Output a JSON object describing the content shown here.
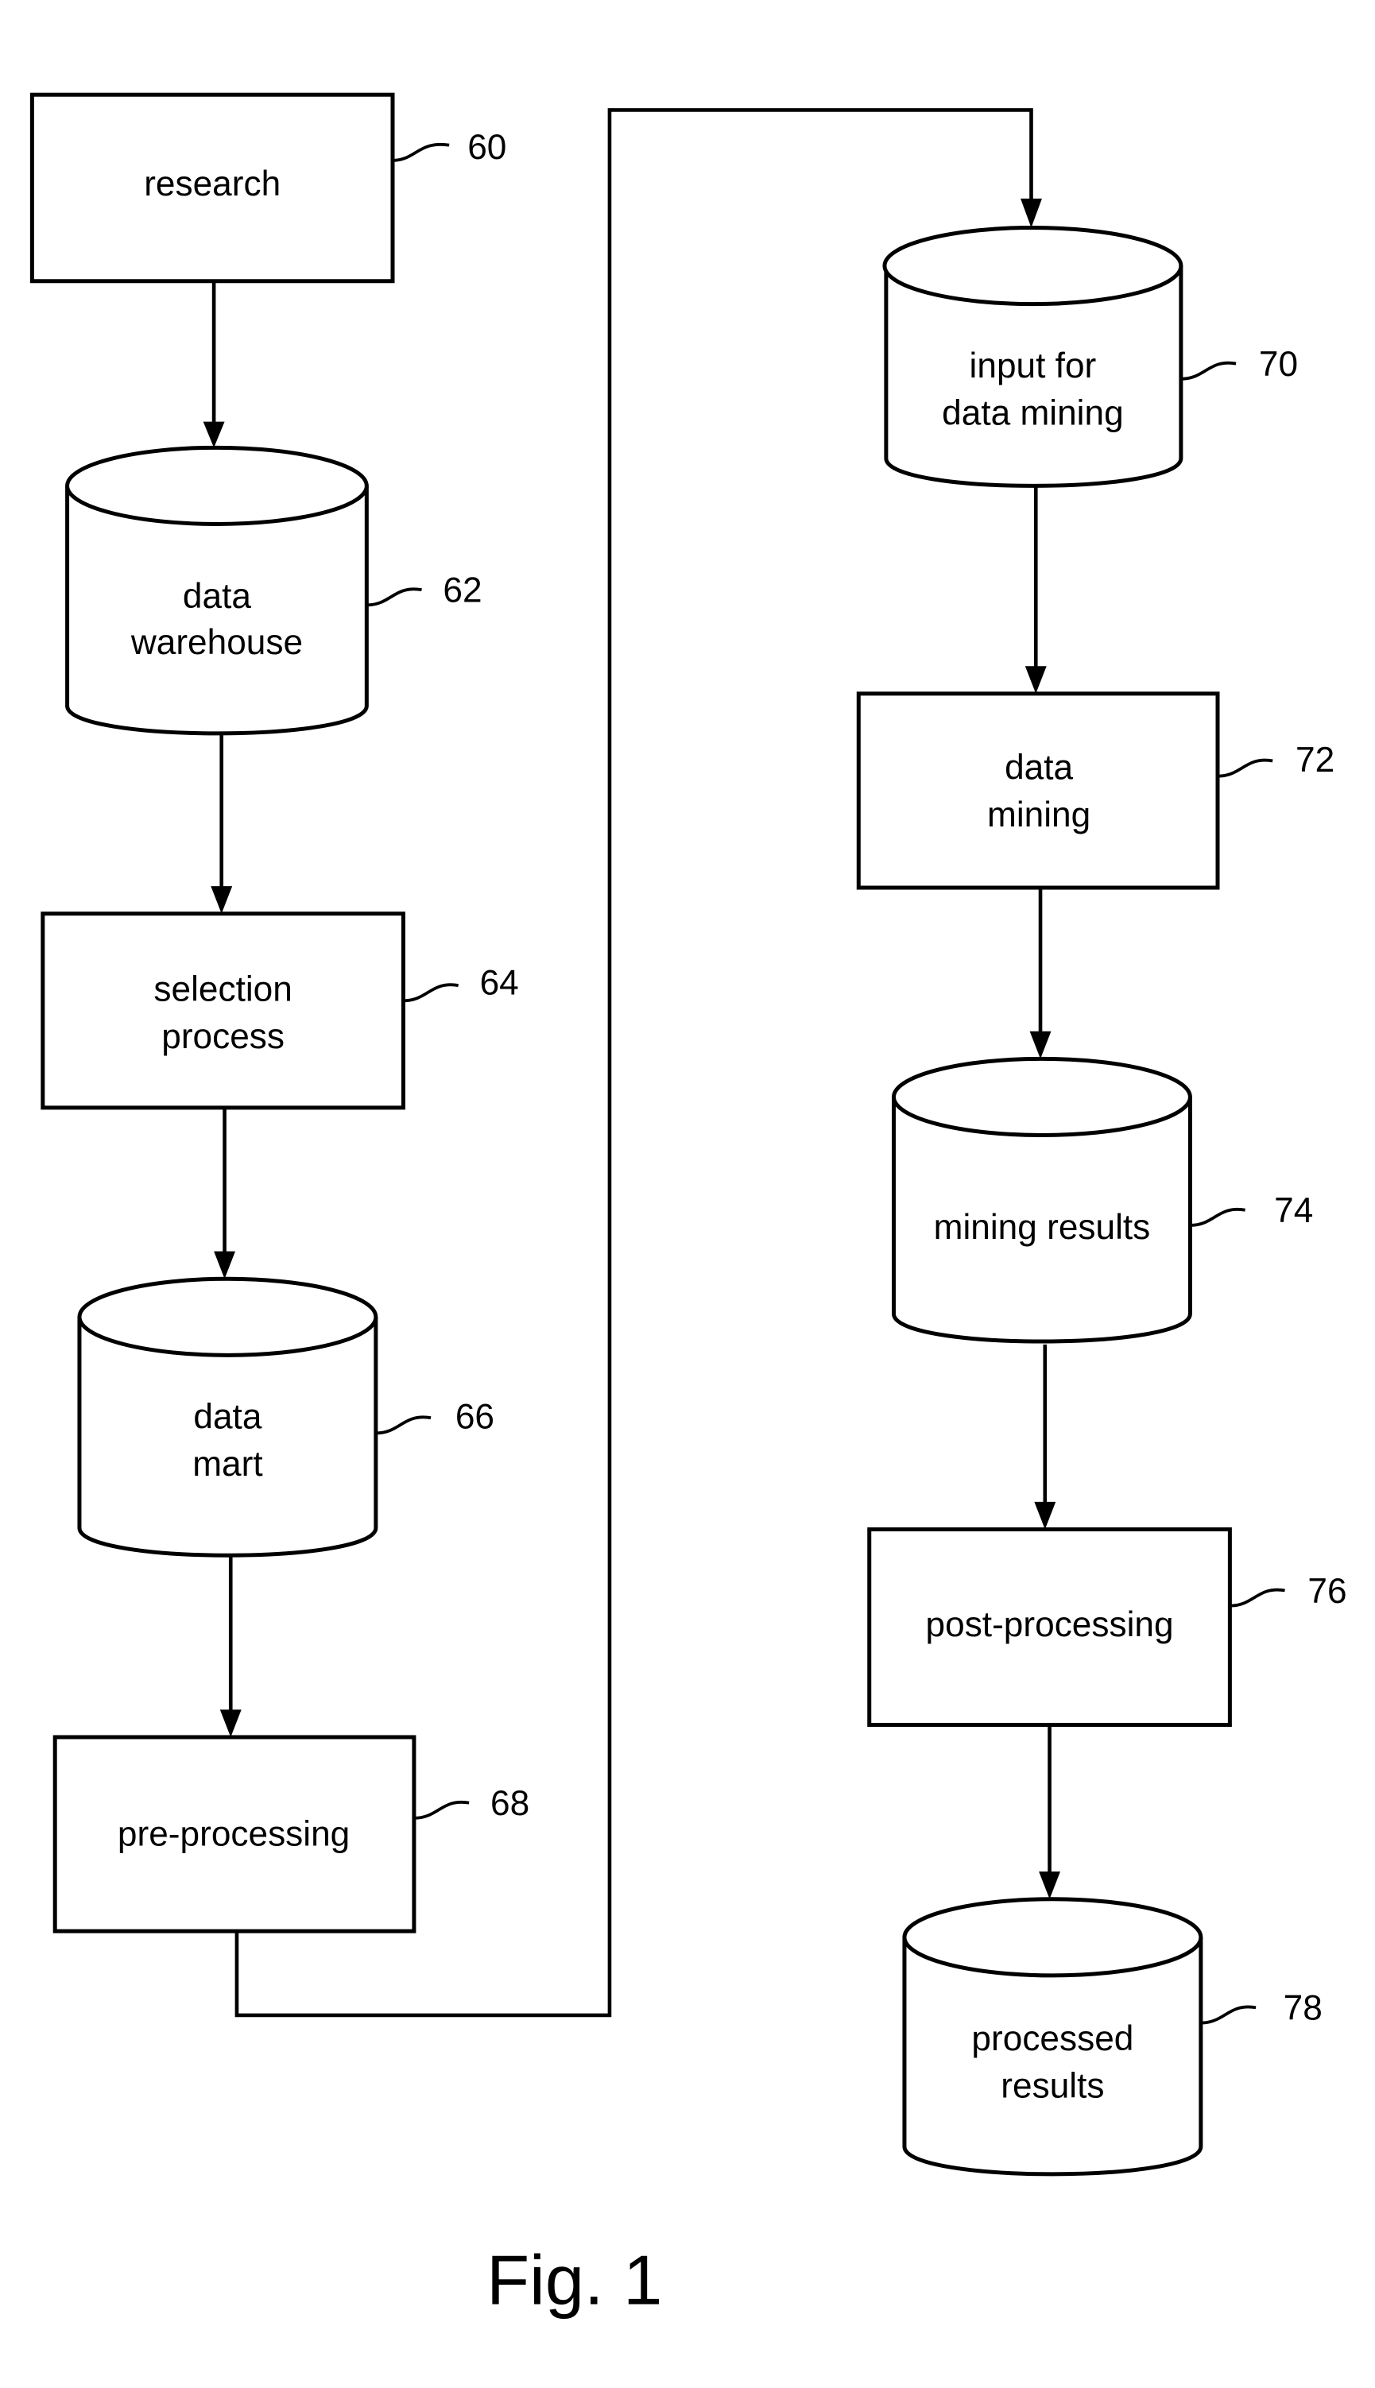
{
  "figure": {
    "caption": "Fig. 1",
    "line_color": "#000000",
    "background": "#ffffff"
  },
  "nodes": [
    {
      "id": "60",
      "shape": "rectangle",
      "lines": [
        "research"
      ],
      "ref": "60"
    },
    {
      "id": "62",
      "shape": "cylinder",
      "lines": [
        "data",
        "warehouse"
      ],
      "ref": "62"
    },
    {
      "id": "64",
      "shape": "rectangle",
      "lines": [
        "selection",
        "process"
      ],
      "ref": "64"
    },
    {
      "id": "66",
      "shape": "cylinder",
      "lines": [
        "data",
        "mart"
      ],
      "ref": "66"
    },
    {
      "id": "68",
      "shape": "rectangle",
      "lines": [
        "pre-processing"
      ],
      "ref": "68"
    },
    {
      "id": "70",
      "shape": "cylinder",
      "lines": [
        "input for",
        "data mining"
      ],
      "ref": "70"
    },
    {
      "id": "72",
      "shape": "rectangle",
      "lines": [
        "data",
        "mining"
      ],
      "ref": "72"
    },
    {
      "id": "74",
      "shape": "cylinder",
      "lines": [
        "mining results"
      ],
      "ref": "74"
    },
    {
      "id": "76",
      "shape": "rectangle",
      "lines": [
        "post-processing"
      ],
      "ref": "76"
    },
    {
      "id": "78",
      "shape": "cylinder",
      "lines": [
        "processed",
        "results"
      ],
      "ref": "78"
    }
  ],
  "edges": [
    {
      "from": "60",
      "to": "62"
    },
    {
      "from": "62",
      "to": "64"
    },
    {
      "from": "64",
      "to": "66"
    },
    {
      "from": "66",
      "to": "68"
    },
    {
      "from": "68",
      "to": "70"
    },
    {
      "from": "70",
      "to": "72"
    },
    {
      "from": "72",
      "to": "74"
    },
    {
      "from": "74",
      "to": "76"
    },
    {
      "from": "76",
      "to": "78"
    }
  ]
}
